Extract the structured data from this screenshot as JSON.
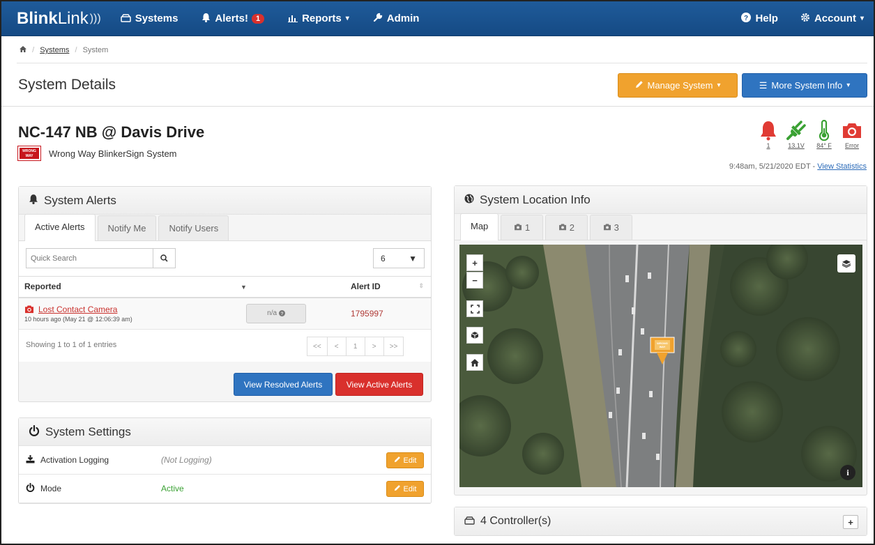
{
  "nav": {
    "brand_bold": "Blink",
    "brand_light": "Link",
    "systems": "Systems",
    "alerts": "Alerts!",
    "alerts_badge": "1",
    "reports": "Reports",
    "admin": "Admin",
    "help": "Help",
    "account": "Account"
  },
  "breadcrumb": {
    "systems": "Systems",
    "sep": "/",
    "current": "System"
  },
  "page": {
    "title": "System Details",
    "manage_btn": "Manage System",
    "more_btn": "More System Info"
  },
  "system": {
    "name": "NC-147 NB @ Davis Drive",
    "type": "Wrong Way BlinkerSign System",
    "sign_text": "WRONG WAY",
    "status": [
      {
        "icon": "bell-icon",
        "label": "1",
        "color": "#e03b34"
      },
      {
        "icon": "plug-icon",
        "label": "13.1V",
        "color": "#3aa133"
      },
      {
        "icon": "thermometer-icon",
        "label": "84° F",
        "color": "#3aa133"
      },
      {
        "icon": "camera-icon",
        "label": "Error",
        "color": "#e03b34"
      }
    ],
    "timestamp": "9:48am, 5/21/2020 EDT -",
    "view_stats": "View Statistics"
  },
  "alerts_panel": {
    "title": "System Alerts",
    "tabs": [
      "Active Alerts",
      "Notify Me",
      "Notify Users"
    ],
    "search_placeholder": "Quick Search",
    "page_length": "6",
    "columns": {
      "reported": "Reported",
      "alert_id": "Alert ID"
    },
    "rows": [
      {
        "title": "Lost Contact Camera",
        "time": "10 hours ago (May 21 @ 12:06:39 am)",
        "na": "n/a",
        "id": "1795997"
      }
    ],
    "showing": "Showing 1 to 1 of 1 entries",
    "pager": [
      "<<",
      "<",
      "1",
      ">",
      ">>"
    ],
    "btn_resolved": "View Resolved Alerts",
    "btn_active": "View Active Alerts"
  },
  "settings_panel": {
    "title": "System Settings",
    "rows": [
      {
        "label": "Activation Logging",
        "value": "(Not Logging)",
        "edit": "Edit"
      },
      {
        "label": "Mode",
        "value": "Active",
        "edit": "Edit"
      }
    ]
  },
  "location_panel": {
    "title": "System Location Info",
    "tabs": [
      "Map",
      "1",
      "2",
      "3"
    ],
    "zoom_in": "+",
    "zoom_out": "−",
    "marker_text": "WRONG WAY"
  },
  "controllers": {
    "title": "4 Controller(s)",
    "expand": "+"
  },
  "colors": {
    "navbar": "#1a5593",
    "orange": "#f0a22e",
    "blue": "#2f74c0",
    "red": "#d9302c",
    "green": "#3aa133"
  }
}
